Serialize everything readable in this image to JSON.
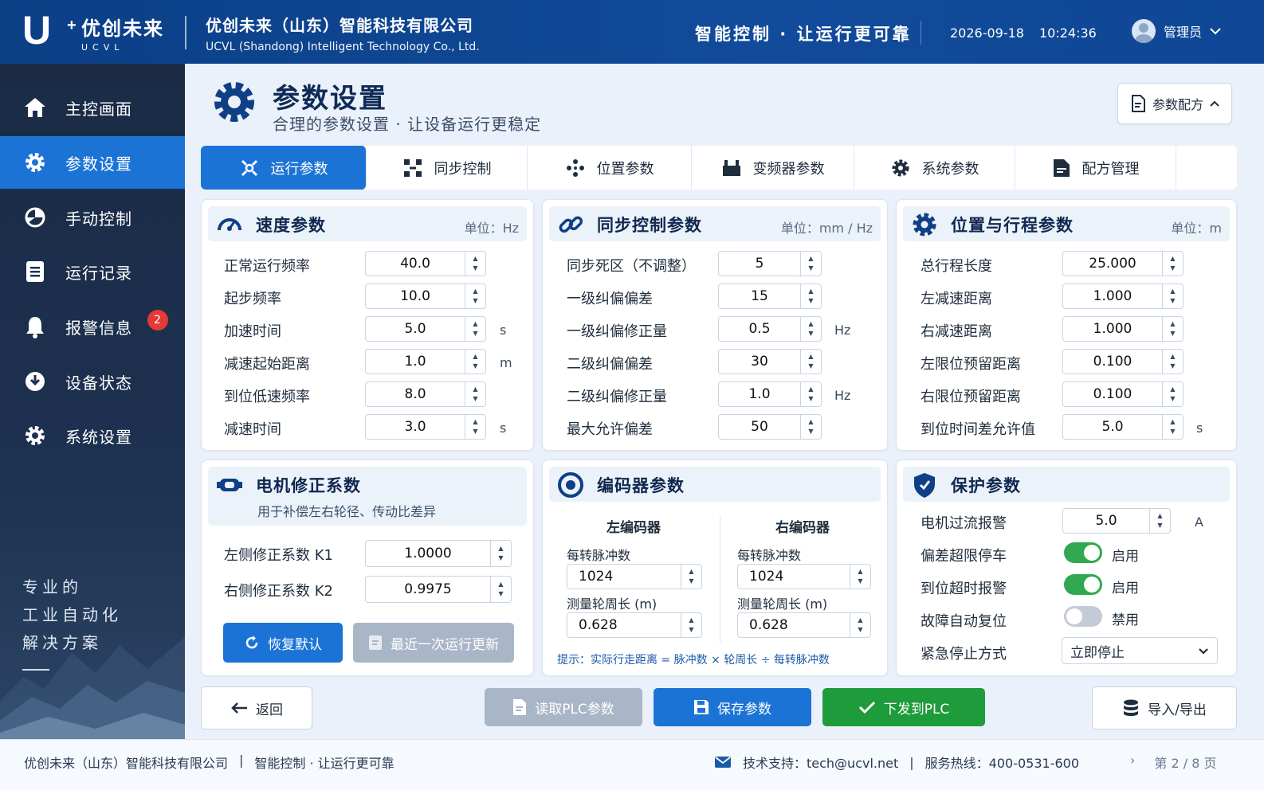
{
  "header": {
    "logo_cn": "优创未来",
    "logo_en": "UCVL",
    "company_cn": "优创未来（山东）智能科技有限公司",
    "company_en": "UCVL (Shandong) Intelligent Technology Co., Ltd.",
    "slogan": "智能控制 · 让运行更可靠",
    "date": "2026-09-18",
    "time": "10:24:36",
    "user": "管理员"
  },
  "sidebar": {
    "items": [
      {
        "label": "主控画面",
        "icon": "home-icon"
      },
      {
        "label": "参数设置",
        "icon": "gear-icon",
        "active": true
      },
      {
        "label": "手动控制",
        "icon": "hand-control-icon"
      },
      {
        "label": "运行记录",
        "icon": "log-icon"
      },
      {
        "label": "报警信息",
        "icon": "bell-icon",
        "badge": "2"
      },
      {
        "label": "设备状态",
        "icon": "device-status-icon"
      },
      {
        "label": "系统设置",
        "icon": "gear-icon"
      }
    ],
    "slogan_lines": [
      "专业的",
      "工业自动化",
      "解决方案"
    ]
  },
  "page": {
    "title": "参数设置",
    "subtitle": "合理的参数设置 · 让设备运行更稳定",
    "recipe_button": "参数配方"
  },
  "tabs": [
    "运行参数",
    "同步控制",
    "位置参数",
    "变频器参数",
    "系统参数",
    "配方管理"
  ],
  "speed": {
    "title": "速度参数",
    "unit": "单位：Hz",
    "rows": [
      {
        "label": "正常运行频率",
        "value": "40.0",
        "unit": ""
      },
      {
        "label": "起步频率",
        "value": "10.0",
        "unit": ""
      },
      {
        "label": "加速时间",
        "value": "5.0",
        "unit": "s"
      },
      {
        "label": "减速起始距离",
        "value": "1.0",
        "unit": "m"
      },
      {
        "label": "到位低速频率",
        "value": "8.0",
        "unit": ""
      },
      {
        "label": "减速时间",
        "value": "3.0",
        "unit": "s"
      }
    ]
  },
  "sync": {
    "title": "同步控制参数",
    "unit": "单位：mm / Hz",
    "rows": [
      {
        "label": "同步死区（不调整）",
        "value": "5",
        "unit": ""
      },
      {
        "label": "一级纠偏偏差",
        "value": "15",
        "unit": ""
      },
      {
        "label": "一级纠偏修正量",
        "value": "0.5",
        "unit": "Hz"
      },
      {
        "label": "二级纠偏偏差",
        "value": "30",
        "unit": ""
      },
      {
        "label": "二级纠偏修正量",
        "value": "1.0",
        "unit": "Hz"
      },
      {
        "label": "最大允许偏差",
        "value": "50",
        "unit": ""
      }
    ]
  },
  "position": {
    "title": "位置与行程参数",
    "unit": "单位：m",
    "rows": [
      {
        "label": "总行程长度",
        "value": "25.000",
        "unit": ""
      },
      {
        "label": "左减速距离",
        "value": "1.000",
        "unit": ""
      },
      {
        "label": "右减速距离",
        "value": "1.000",
        "unit": ""
      },
      {
        "label": "左限位预留距离",
        "value": "0.100",
        "unit": ""
      },
      {
        "label": "右限位预留距离",
        "value": "0.100",
        "unit": ""
      },
      {
        "label": "到位时间差允许值",
        "value": "5.0",
        "unit": "s"
      }
    ]
  },
  "motor": {
    "title": "电机修正系数",
    "subtitle": "用于补偿左右轮径、传动比差异",
    "k1_label": "左侧修正系数 K1",
    "k1_value": "1.0000",
    "k2_label": "右侧修正系数 K2",
    "k2_value": "0.9975",
    "restore_button": "恢复默认",
    "recent_button": "最近一次运行更新"
  },
  "encoder": {
    "title": "编码器参数",
    "left_title": "左编码器",
    "right_title": "右编码器",
    "ppr_label": "每转脉冲数",
    "circ_label": "测量轮周长 (m)",
    "left_ppr": "1024",
    "left_circ": "0.628",
    "right_ppr": "1024",
    "right_circ": "0.628",
    "hint": "提示：实际行走距离 = 脉冲数 × 轮周长 ÷ 每转脉冲数"
  },
  "protection": {
    "title": "保护参数",
    "overcurrent_label": "电机过流报警",
    "overcurrent_value": "5.0",
    "overcurrent_unit": "A",
    "toggles": [
      {
        "label": "偏差超限停车",
        "state": "启用",
        "on": true
      },
      {
        "label": "到位超时报警",
        "state": "启用",
        "on": true
      },
      {
        "label": "故障自动复位",
        "state": "禁用",
        "on": false
      }
    ],
    "estop_label": "紧急停止方式",
    "estop_value": "立即停止"
  },
  "actions": {
    "back": "返回",
    "read_plc": "读取PLC参数",
    "save": "保存参数",
    "send_plc": "下发到PLC",
    "import_export": "导入/导出"
  },
  "footer": {
    "company": "优创未来（山东）智能科技有限公司",
    "sep": "|",
    "slogan": "智能控制 · 让运行更可靠",
    "support": "技术支持：tech@ucvl.net",
    "hotline": "服务热线：400-0531-600",
    "page": "第 2 / 8 页"
  },
  "colors": {
    "primary": "#1b73d6",
    "header": "#114b9a",
    "sidebar": "#1d3150",
    "green": "#1e9b3a",
    "badge": "#e53935"
  }
}
